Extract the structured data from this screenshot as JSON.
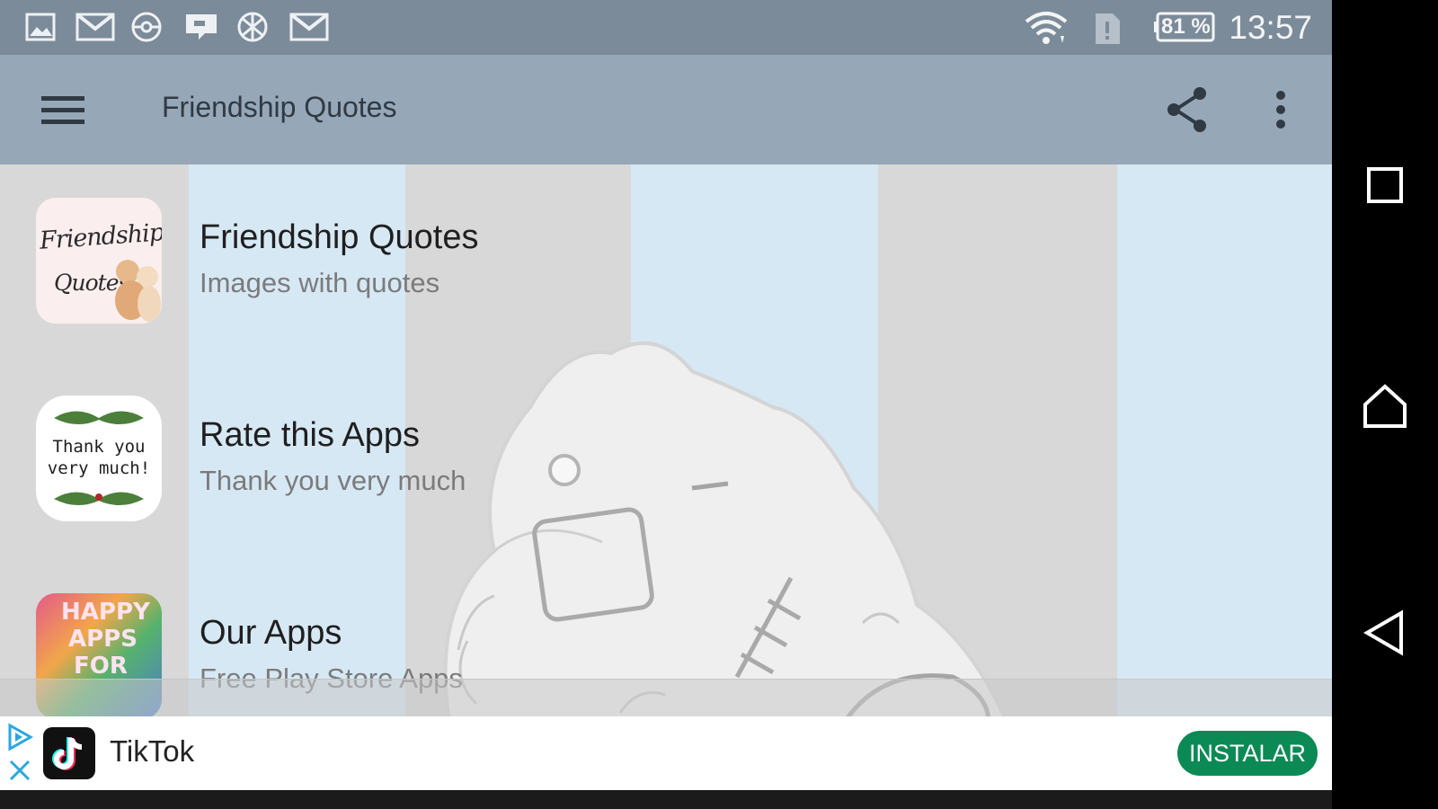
{
  "status_bar": {
    "time": "13:57",
    "battery": "81 %",
    "notification_icons": [
      "image-icon",
      "gmail-icon",
      "pokeball-icon",
      "message-icon",
      "basketball-icon",
      "gmail-icon"
    ],
    "system_icons": [
      "wifi-icon",
      "no-sim-icon",
      "battery-icon"
    ]
  },
  "toolbar": {
    "title": "Friendship Quotes",
    "menu_icon": "hamburger-menu-icon",
    "share_icon": "share-icon",
    "overflow_icon": "more-vert-icon",
    "background": "#96a7b8"
  },
  "list": [
    {
      "title": "Friendship Quotes",
      "subtitle": "Images with quotes",
      "thumb_text": [
        "Friendship",
        "Quotes"
      ]
    },
    {
      "title": "Rate this Apps",
      "subtitle": "Thank you very much",
      "thumb_text": [
        "Thank you",
        "very much!"
      ]
    },
    {
      "title": "Our Apps",
      "subtitle": "Free Play Store Apps",
      "thumb_text": [
        "HAPPY",
        "APPS",
        "FOR"
      ]
    }
  ],
  "ad": {
    "title": "TikTok",
    "install_label": "INSTALAR",
    "button_color": "#0b8a55"
  },
  "nav_bar": {
    "icons": [
      "recents-square-icon",
      "home-icon",
      "back-triangle-icon"
    ]
  }
}
